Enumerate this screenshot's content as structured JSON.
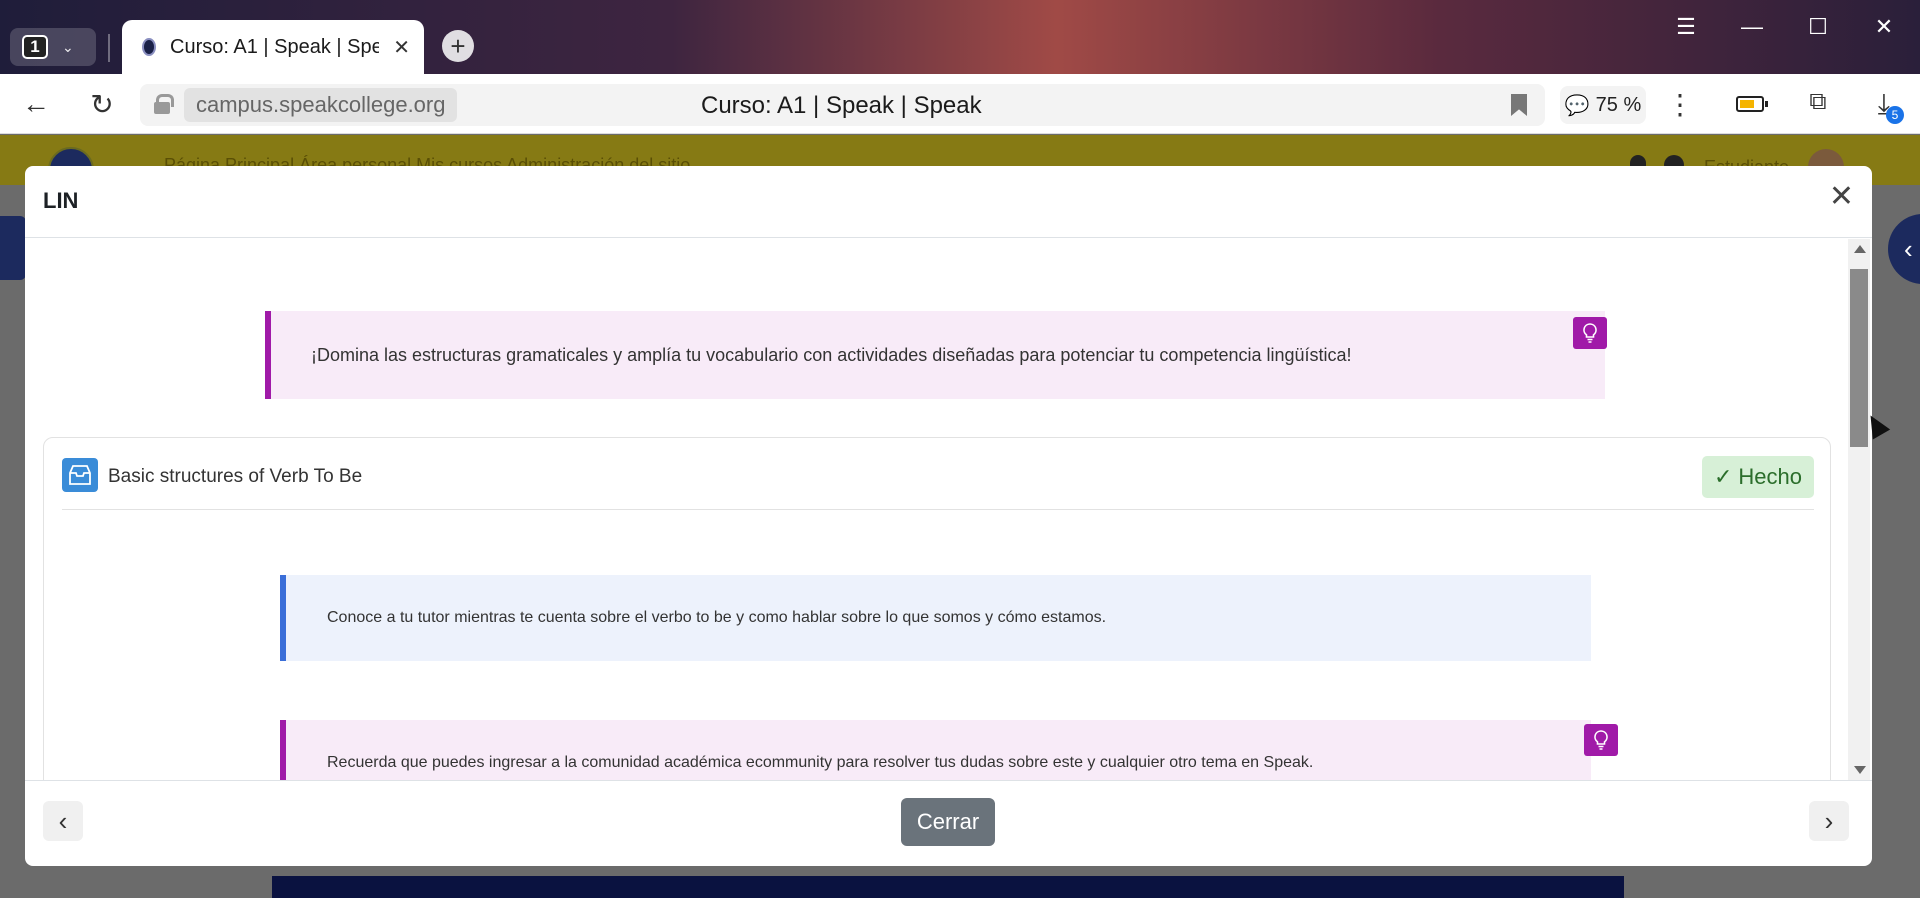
{
  "browser": {
    "tab_count": "1",
    "tab_title": "Curso: A1 | Speak | Speak",
    "url_host": "campus.speakcollege.org",
    "page_title": "Curso: A1 | Speak | Speak",
    "zoom": "75 %",
    "downloads_badge": "5"
  },
  "page_behind": {
    "nav_links": "Página Principal   Área personal   Mis cursos   Administración del sitio",
    "user_label": "Estudiante"
  },
  "modal": {
    "title": "LIN",
    "intro_callout": "¡Domina las estructuras gramaticales y amplía tu vocabulario con actividades diseñadas para potenciar tu competencia lingüística!",
    "activity": {
      "name": "Basic structures of Verb To Be",
      "status": "Hecho"
    },
    "info_callout": "Conoce a tu tutor mientras te cuenta sobre el verbo to be y como hablar sobre lo que somos y cómo estamos.",
    "tip_callout": "Recuerda que puedes ingresar a la comunidad académica ecommunity para resolver tus dudas sobre este y cualquier otro tema en Speak.",
    "close_button": "Cerrar"
  },
  "colors": {
    "accent_magenta": "#a01aa8",
    "accent_blue": "#3a6ed8",
    "done_green": "#2b6e2b",
    "nav_olive": "#867a14"
  },
  "icons": [
    "lightbulb-icon",
    "box-icon",
    "check-icon",
    "close-icon",
    "chevron-left-icon",
    "chevron-right-icon"
  ]
}
